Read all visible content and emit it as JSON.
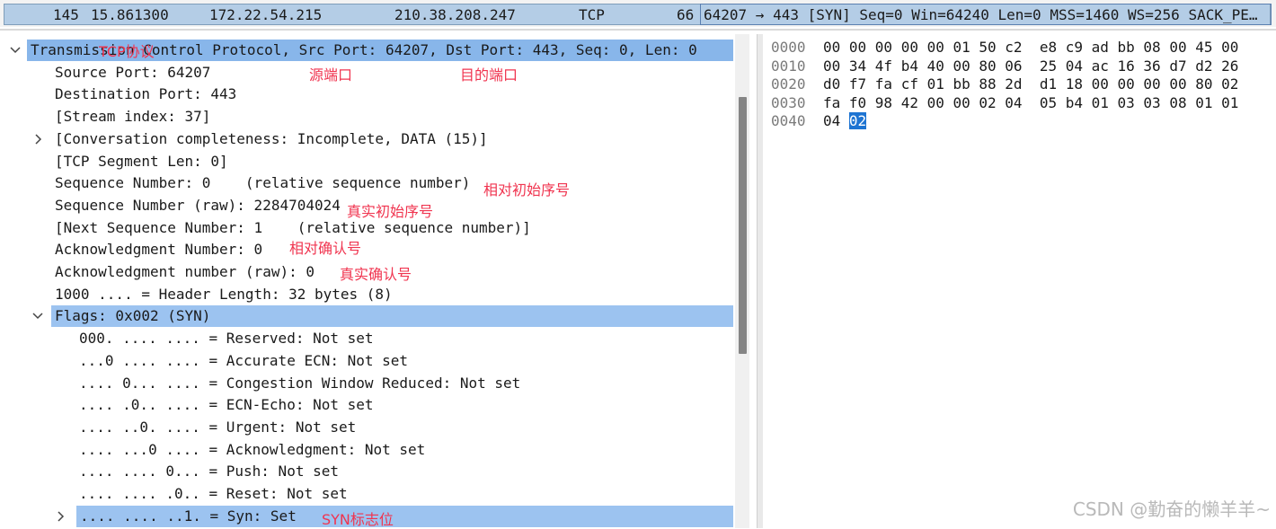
{
  "packet_list": {
    "number": "145",
    "time": "15.861300",
    "source": "172.22.54.215",
    "destination": "210.38.208.247",
    "protocol": "TCP",
    "length": "66",
    "info": "64207 → 443 [SYN] Seq=0 Win=64240 Len=0 MSS=1460 WS=256 SACK_PE…"
  },
  "tree": [
    {
      "text": "Transmission Control Protocol, Src Port: 64207, Dst Port: 443, Seq: 0, Len: 0",
      "expander": "expanded"
    },
    {
      "text": "Source Port: 64207",
      "expander": "none"
    },
    {
      "text": "Destination Port: 443",
      "expander": "none"
    },
    {
      "text": "[Stream index: 37]",
      "expander": "none"
    },
    {
      "text": "[Conversation completeness: Incomplete, DATA (15)]",
      "expander": "collapsed"
    },
    {
      "text": "[TCP Segment Len: 0]",
      "expander": "none"
    },
    {
      "text": "Sequence Number: 0    (relative sequence number)",
      "expander": "none"
    },
    {
      "text": "Sequence Number (raw): 2284704024",
      "expander": "none"
    },
    {
      "text": "[Next Sequence Number: 1    (relative sequence number)]",
      "expander": "none"
    },
    {
      "text": "Acknowledgment Number: 0",
      "expander": "none"
    },
    {
      "text": "Acknowledgment number (raw): 0",
      "expander": "none"
    },
    {
      "text": "1000 .... = Header Length: 32 bytes (8)",
      "expander": "none"
    },
    {
      "text": "Flags: 0x002 (SYN)",
      "expander": "expanded"
    },
    {
      "text": "000. .... .... = Reserved: Not set",
      "expander": "none"
    },
    {
      "text": "...0 .... .... = Accurate ECN: Not set",
      "expander": "none"
    },
    {
      "text": ".... 0... .... = Congestion Window Reduced: Not set",
      "expander": "none"
    },
    {
      "text": ".... .0.. .... = ECN-Echo: Not set",
      "expander": "none"
    },
    {
      "text": ".... ..0. .... = Urgent: Not set",
      "expander": "none"
    },
    {
      "text": ".... ...0 .... = Acknowledgment: Not set",
      "expander": "none"
    },
    {
      "text": ".... .... 0... = Push: Not set",
      "expander": "none"
    },
    {
      "text": ".... .... .0.. = Reset: Not set",
      "expander": "none"
    },
    {
      "text": ".... .... ..1. = Syn: Set",
      "expander": "collapsed"
    }
  ],
  "annotations": {
    "tcp_header": "TCP协议",
    "src_port": "源端口",
    "dst_port": "目的端口",
    "rel_seq": "相对初始序号",
    "raw_seq": "真实初始序号",
    "rel_ack": "相对确认号",
    "raw_ack": "真实确认号",
    "syn_flag": "SYN标志位"
  },
  "hex": {
    "rows": [
      {
        "offset": "0000",
        "bytes": "00 00 00 00 00 01 50 c2  e8 c9 ad bb 08 00 45 00"
      },
      {
        "offset": "0010",
        "bytes": "00 34 4f b4 40 00 80 06  25 04 ac 16 36 d7 d2 26"
      },
      {
        "offset": "0020",
        "bytes": "d0 f7 fa cf 01 bb 88 2d  d1 18 00 00 00 00 80 02"
      },
      {
        "offset": "0030",
        "bytes": "fa f0 98 42 00 00 02 04  05 b4 01 03 03 08 01 01"
      },
      {
        "offset": "0040",
        "bytes_before": "04 ",
        "bytes_highlight": "02"
      }
    ],
    "ascii_marker": "·"
  },
  "watermark": "CSDN @勤奋的懒羊羊~"
}
